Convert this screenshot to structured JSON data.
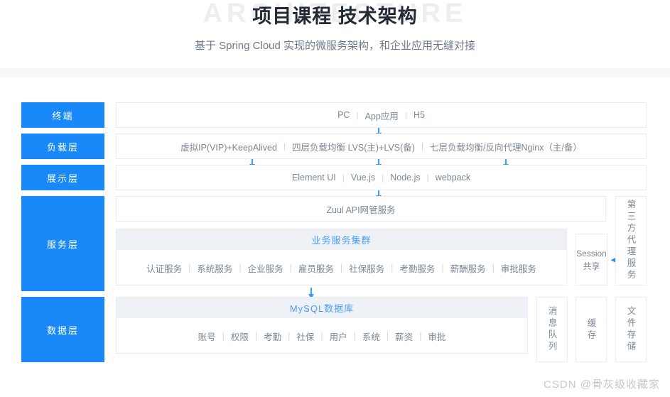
{
  "header": {
    "watermark": "ARCHITECTURE",
    "title": "项目课程 技术架构",
    "subtitle": "基于 Spring Cloud 实现的微服务架构，和企业应用无缝对接"
  },
  "layers": {
    "terminal": "终端",
    "load": "负载层",
    "display": "展示层",
    "service": "服务层",
    "data": "数据层"
  },
  "rows": {
    "terminal_items": [
      "PC",
      "App应用",
      "H5"
    ],
    "load_items": [
      "虚拟IP(VIP)+KeepAlived",
      "四层负载均衡 LVS(主)+LVS(备)",
      "七层负载均衡/反向代理Nginx（主/备）"
    ],
    "display_items": [
      "Element UI",
      "Vue.js",
      "Node.js",
      "webpack"
    ],
    "gateway": "Zuul API网管服务"
  },
  "service_cluster": {
    "title": "业务服务集群",
    "items": [
      "认证服务",
      "系统服务",
      "企业服务",
      "雇员服务",
      "社保服务",
      "考勤服务",
      "薪酬服务",
      "审批服务"
    ]
  },
  "database": {
    "title": "MySQL数据库",
    "items": [
      "账号",
      "权限",
      "考勤",
      "社保",
      "用户",
      "系统",
      "薪资",
      "审批"
    ]
  },
  "side_boxes": {
    "session": "Session\n共享",
    "session_line1": "Session",
    "session_line2": "共享",
    "third_party": "第三方代理服务",
    "message_queue": "消息队列",
    "cache": "缓存",
    "file_storage": "文件存储"
  },
  "watermark_bottom": "CSDN @骨灰级收藏家",
  "colors": {
    "accent_blue": "#1989fa",
    "arrow_blue": "#3b9bfa",
    "section_head_bg": "#eef2f7",
    "section_head_text": "#4a9df8",
    "body_text": "#7c8894",
    "border": "#e9edf2"
  }
}
